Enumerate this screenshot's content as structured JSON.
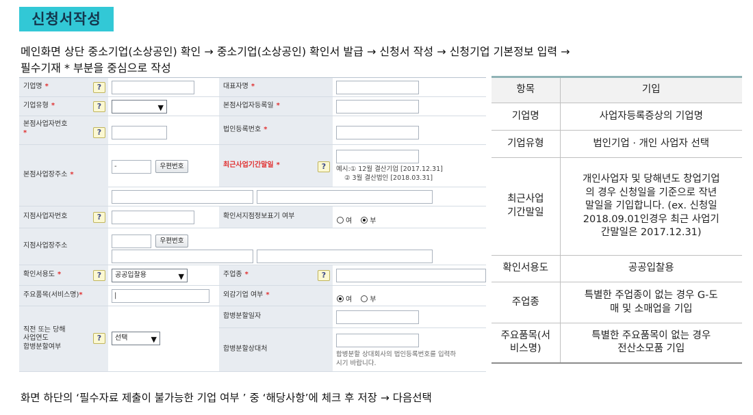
{
  "title": "신청서작성",
  "intro": {
    "line1": "메인화면 상단 중소기업(소상공인) 확인 → 중소기업(소상공인) 확인서 발급 → 신청서 작성 → 신청기업 기본정보 입력 →",
    "line2": "필수기재 * 부분을 중심으로 작성"
  },
  "form": {
    "required_mark": "*",
    "help_icon": "?",
    "labels": {
      "company_name": "기업명",
      "company_type": "기업유형",
      "hq_biz_number": "본점사업자번호",
      "hq_address": "본점사업장주소",
      "branch_biz_number": "지점사업자번호",
      "branch_address": "지점사업장주소",
      "purpose": "확인서용도",
      "main_product": "주요품목(서비스명)",
      "merger_year": [
        "직전 또는 당해",
        "사업연도",
        "합병분할여부"
      ],
      "ceo_name": "대표자명",
      "hq_registration_date": "본점사업자등록일",
      "corp_reg_number": "법인등록번호",
      "recent_fiscal_end": "최근사업기간말일",
      "branch_info_display": "확인서지점정보표기 여부",
      "main_industry": "주업종",
      "foreign_invested": "외감기업 여부",
      "merger_date": "합병분할일자",
      "merger_counterparty": "합병분할상대처"
    },
    "zip_button": "우편번호",
    "purpose_value": "공공입찰용",
    "main_product_value": "|",
    "hq_address_prefix": "-",
    "merger_select_value": "선택",
    "fiscal_example": {
      "line1": "예시:① 12월 결산기업 [2017.12.31]",
      "line2": "② 3월 결산법인 [2018.03.31]"
    },
    "radio_yes": "여",
    "radio_no": "부",
    "merger_hint": {
      "line1": "합병분할 상대회사의 법인등록번호를 입력하",
      "line2": "시기 바랍니다."
    }
  },
  "table": {
    "headers": [
      "항목",
      "기입"
    ],
    "rows": [
      {
        "item": "기업명",
        "entry": "사업자등록증상의 기업명"
      },
      {
        "item": "기업유형",
        "entry": "법인기업 · 개인 사업자 선택"
      },
      {
        "item": "최근사업\n기간말일",
        "entry": "개인사업자 및 당해년도 창업기업\n의 경우 신청일을 기준으로 작년\n말일을 기입합니다. (ex. 신청일\n2018.09.01인경우 최근 사업기\n간말일은 2017.12.31)"
      },
      {
        "item": "확인서용도",
        "entry": "공공입찰용"
      },
      {
        "item": "주업종",
        "entry": "특별한 주업종이 없는 경우 G-도\n매 및 소매업을 기입"
      },
      {
        "item": "주요품목(서\n비스명)",
        "entry": "특별한 주요품목이 없는 경우\n전산소모품 기입"
      }
    ]
  },
  "footer": "화면 하단의 ‘필수자료 제출이 불가능한 기업 여부 ’  중 ‘해당사항’에 체크 후 저장 → 다음선택"
}
